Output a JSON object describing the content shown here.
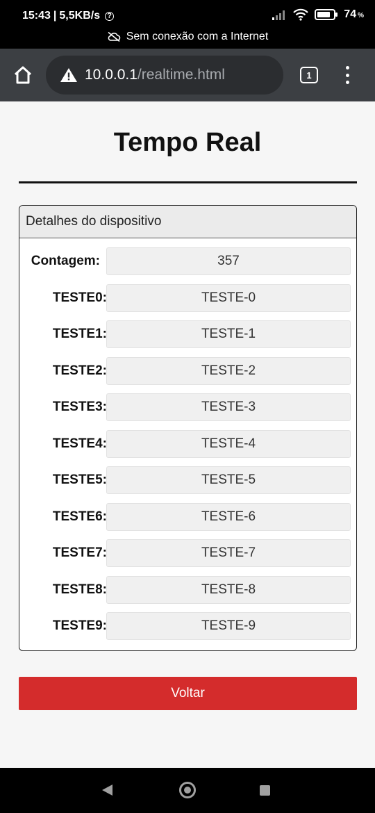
{
  "status_bar": {
    "time": "15:43",
    "speed": "5,5KB/s",
    "help_glyph": "?",
    "battery": "74",
    "battery_unit": "%",
    "offline_notice": "Sem conexão com a Internet"
  },
  "browser": {
    "url_host": "10.0.0.1",
    "url_path": "/realtime.html",
    "tab_count": "1"
  },
  "page": {
    "title": "Tempo Real",
    "card_header": "Detalhes do dispositivo",
    "rows": [
      {
        "label": "Contagem:",
        "value": "357"
      },
      {
        "label": "TESTE0:",
        "value": "TESTE-0"
      },
      {
        "label": "TESTE1:",
        "value": "TESTE-1"
      },
      {
        "label": "TESTE2:",
        "value": "TESTE-2"
      },
      {
        "label": "TESTE3:",
        "value": "TESTE-3"
      },
      {
        "label": "TESTE4:",
        "value": "TESTE-4"
      },
      {
        "label": "TESTE5:",
        "value": "TESTE-5"
      },
      {
        "label": "TESTE6:",
        "value": "TESTE-6"
      },
      {
        "label": "TESTE7:",
        "value": "TESTE-7"
      },
      {
        "label": "TESTE8:",
        "value": "TESTE-8"
      },
      {
        "label": "TESTE9:",
        "value": "TESTE-9"
      }
    ],
    "back_button": "Voltar"
  },
  "colors": {
    "accent_red": "#d42c2c",
    "browser_bar": "#3c3f43"
  },
  "icons": [
    "signal-icon",
    "wifi-icon",
    "battery-icon",
    "offline-cloud-icon",
    "home-icon",
    "warning-icon",
    "tab-switcher-icon",
    "overflow-menu-icon",
    "nav-back-icon",
    "nav-home-icon",
    "nav-recents-icon"
  ]
}
